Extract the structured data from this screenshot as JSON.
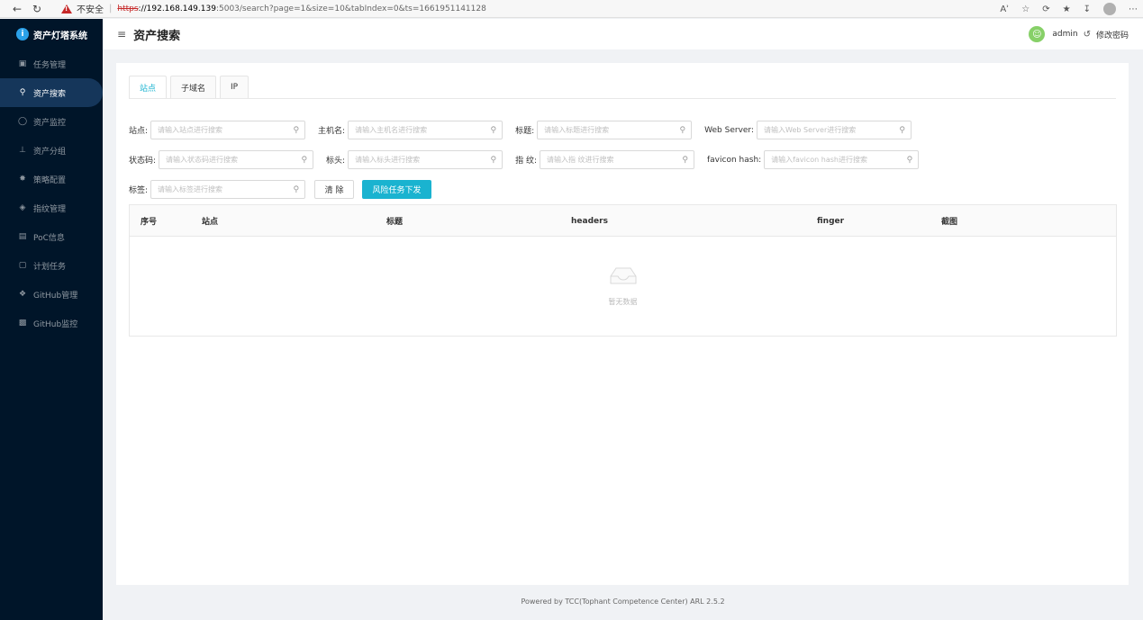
{
  "browser": {
    "warning": "不安全",
    "url_scheme": "https",
    "url_host": "://192.168.149.139",
    "url_rest": ":5003/search?page=1&size=10&tabIndex=0&ts=1661951141128"
  },
  "sidebar": {
    "brand": "资产灯塔系统",
    "items": [
      {
        "label": "任务管理",
        "icon": "task-icon"
      },
      {
        "label": "资产搜索",
        "icon": "search-icon"
      },
      {
        "label": "资产监控",
        "icon": "monitor-icon"
      },
      {
        "label": "资产分组",
        "icon": "group-icon"
      },
      {
        "label": "策略配置",
        "icon": "policy-icon"
      },
      {
        "label": "指纹管理",
        "icon": "fingerprint-icon"
      },
      {
        "label": "PoC信息",
        "icon": "poc-icon"
      },
      {
        "label": "计划任务",
        "icon": "schedule-icon"
      },
      {
        "label": "GitHub管理",
        "icon": "github-icon"
      },
      {
        "label": "GitHub监控",
        "icon": "github-monitor-icon"
      }
    ]
  },
  "header": {
    "title": "资产搜索",
    "user": "admin",
    "change_password": "修改密码"
  },
  "tabs": [
    "站点",
    "子域名",
    "IP"
  ],
  "filters": {
    "site": {
      "label": "站点:",
      "placeholder": "请输入站点进行搜索"
    },
    "hostname": {
      "label": "主机名:",
      "placeholder": "请输入主机名进行搜索"
    },
    "title": {
      "label": "标题:",
      "placeholder": "请输入标题进行搜索"
    },
    "webserver": {
      "label": "Web Server:",
      "placeholder": "请输入Web Server进行搜索"
    },
    "status": {
      "label": "状态码:",
      "placeholder": "请输入状态码进行搜索"
    },
    "header": {
      "label": "标头:",
      "placeholder": "请输入标头进行搜索"
    },
    "finger": {
      "label": "指 纹:",
      "placeholder": "请输入指 纹进行搜索"
    },
    "favicon": {
      "label": "favicon hash:",
      "placeholder": "请输入favicon hash进行搜索"
    },
    "tag": {
      "label": "标签:",
      "placeholder": "请输入标签进行搜索"
    },
    "clear_label": "清 除",
    "risk_label": "风险任务下发"
  },
  "table": {
    "columns": [
      "序号",
      "站点",
      "标题",
      "headers",
      "finger",
      "截图"
    ],
    "empty_text": "暂无数据"
  },
  "footer": "Powered by TCC(Tophant Competence Center) ARL 2.5.2",
  "colors": {
    "accent": "#1ab3d0",
    "sidebar": "#001529",
    "avatar": "#87d068"
  }
}
